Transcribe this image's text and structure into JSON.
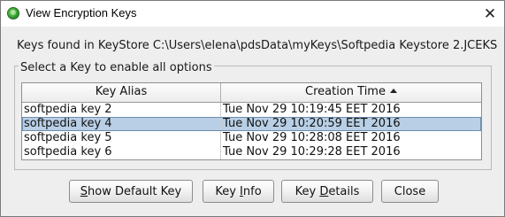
{
  "window": {
    "title": "View Encryption Keys",
    "close_glyph": "✕",
    "app_icon": "green-globe-icon"
  },
  "keystore": {
    "label": "Keys found in KeyStore C:\\Users\\elena\\pdsData\\myKeys\\Softpedia Keystore 2.JCEKS"
  },
  "group": {
    "legend": "Select a Key to enable all options"
  },
  "table": {
    "columns": [
      "Key Alias",
      "Creation Time"
    ],
    "sorted_column": "Creation Time",
    "sort_direction": "ascending",
    "selected_row": 1,
    "rows": [
      {
        "alias": "softpedia key 2",
        "created": "Tue Nov 29 10:19:45 EET 2016"
      },
      {
        "alias": "softpedia key 4",
        "created": "Tue Nov 29 10:20:59 EET 2016"
      },
      {
        "alias": "softpedia key 5",
        "created": "Tue Nov 29 10:28:08 EET 2016"
      },
      {
        "alias": "softpedia key 6",
        "created": "Tue Nov 29 10:29:28 EET 2016"
      }
    ]
  },
  "buttons": {
    "show_default_key": {
      "mnemonic": "S",
      "rest": "how Default Key"
    },
    "key_info": {
      "before": "Key ",
      "mnemonic": "I",
      "after": "nfo"
    },
    "key_details": {
      "before": "Key ",
      "mnemonic": "D",
      "after": "etails"
    },
    "close": "Close"
  },
  "colors": {
    "selection": "#b8cfe5",
    "window_bg": "#eeeeee"
  }
}
